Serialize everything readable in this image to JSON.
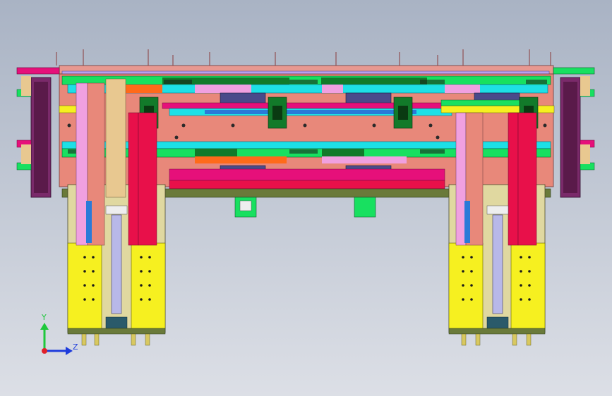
{
  "viewport": {
    "background_top": "#a9b3c4",
    "background_bottom": "#dcdfe6"
  },
  "triad": {
    "y_label": "Y",
    "z_label": "Z",
    "y_color": "#1ec83c",
    "z_color": "#1e3cdc",
    "x_color": "#e0202a"
  },
  "palette": {
    "frame_salmon": "#e8887a",
    "rail_cyan": "#1ee0e6",
    "rail_green": "#18e060",
    "dark_green": "#127a2a",
    "magenta": "#e6107a",
    "crimson": "#e8104a",
    "pink": "#f0a0e0",
    "lavender": "#b8a0f0",
    "slate": "#4a4a8a",
    "orange": "#ff6a1a",
    "yellow": "#f6f020",
    "purple_block": "#7a2a6a",
    "olive": "#6a7a3a",
    "steel": "#6a6a8a",
    "blue": "#2a7ad8",
    "tan": "#e8c890"
  }
}
